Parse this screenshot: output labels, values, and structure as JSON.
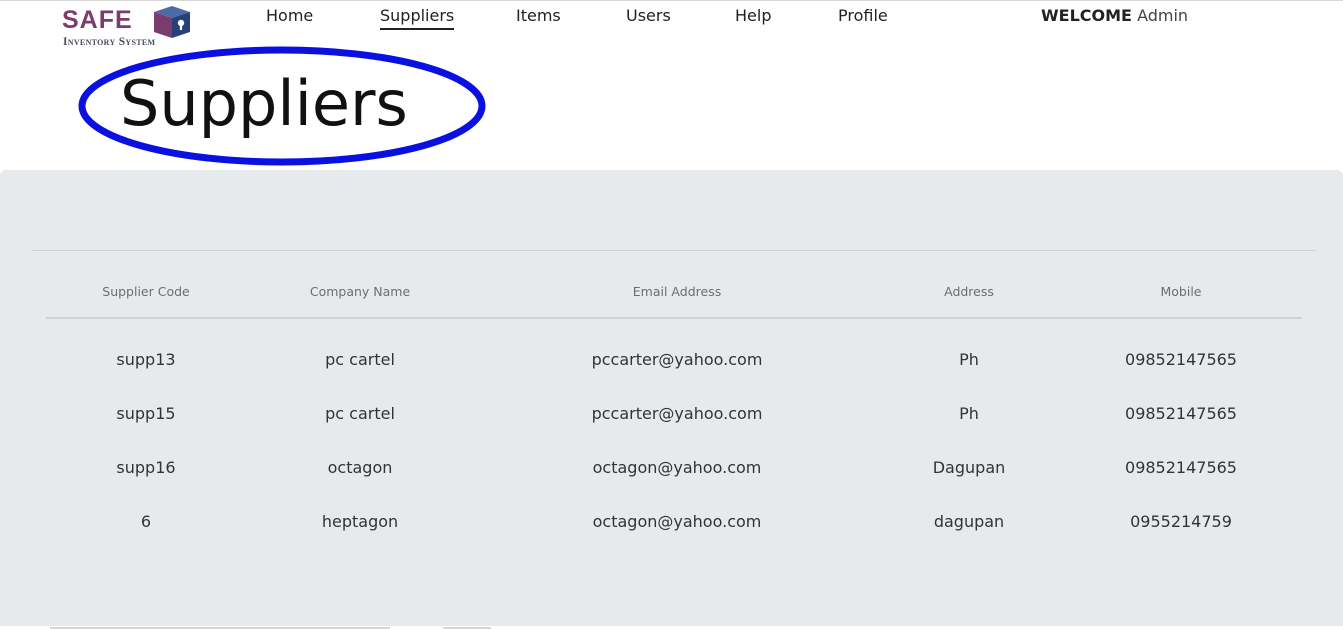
{
  "logo": {
    "word": "SAFE",
    "subtitle": "Inventory System"
  },
  "nav": {
    "items": [
      {
        "label": "Home"
      },
      {
        "label": "Suppliers"
      },
      {
        "label": "Items"
      },
      {
        "label": "Users"
      },
      {
        "label": "Help"
      },
      {
        "label": "Profile"
      }
    ],
    "active": "Suppliers"
  },
  "welcome": {
    "greeting": "WELCOME",
    "user": "Admin"
  },
  "page": {
    "title": "Suppliers"
  },
  "table": {
    "headers": [
      "Supplier Code",
      "Company Name",
      "Email Address",
      "Address",
      "Mobile"
    ],
    "rows": [
      [
        "supp13",
        "pc cartel",
        "pccarter@yahoo.com",
        "Ph",
        "09852147565"
      ],
      [
        "supp15",
        "pc cartel",
        "pccarter@yahoo.com",
        "Ph",
        "09852147565"
      ],
      [
        "supp16",
        "octagon",
        "octagon@yahoo.com",
        "Dagupan",
        "09852147565"
      ],
      [
        "6",
        "heptagon",
        "octagon@yahoo.com",
        "dagupan",
        "0955214759"
      ]
    ]
  },
  "colors": {
    "panel_bg": "#e7eaed",
    "annotation_ellipse": "#0a10e0",
    "logo_text": "#7a3c6e",
    "logo_cube": "#27407a"
  }
}
